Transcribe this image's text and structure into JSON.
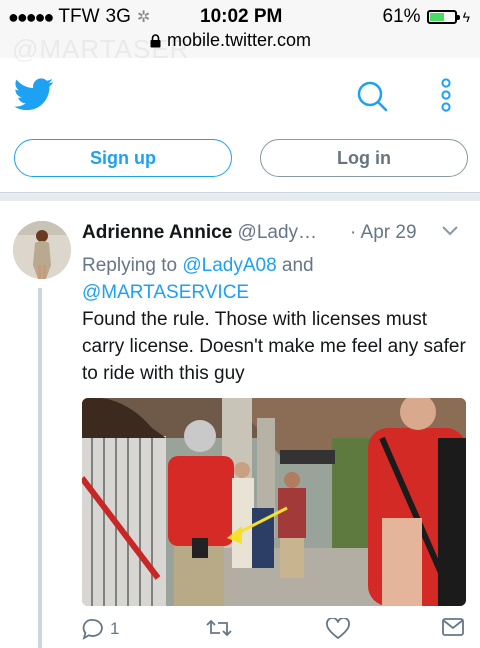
{
  "status_bar": {
    "signal": "●●●●●",
    "carrier": "TFW",
    "network": "3G",
    "time": "10:02 PM",
    "battery": "61%",
    "battery_level": 0.61,
    "url": "mobile.twitter.com",
    "watermark": "@MARTASER"
  },
  "header": {
    "logo": "twitter-bird-icon",
    "search": "search-icon",
    "more": "more-vertical-icon"
  },
  "auth": {
    "signup_label": "Sign up",
    "login_label": "Log in"
  },
  "tweet": {
    "name": "Adrienne Annice",
    "handle": "@Lady…",
    "date": "· Apr 29",
    "reply_prefix": "Replying to ",
    "reply_user1": "@LadyA08",
    "reply_and": " and",
    "reply_user2": "@MARTASERVICE",
    "text": "Found the rule. Those with licenses must carry license. Doesn't make me feel any safer to ride with this guy",
    "reply_count": "1",
    "retweet_count": "",
    "like_count": ""
  },
  "colors": {
    "twitter_blue": "#1da1f2",
    "secondary_text": "#657786"
  }
}
